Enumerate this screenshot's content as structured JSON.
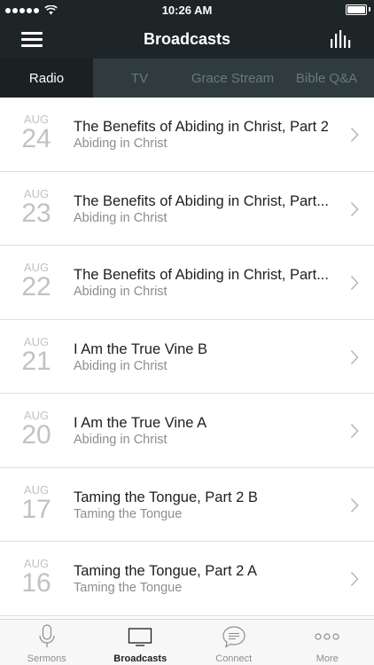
{
  "status": {
    "time": "10:26 AM"
  },
  "nav": {
    "title": "Broadcasts"
  },
  "tabs": [
    {
      "label": "Radio",
      "active": true
    },
    {
      "label": "TV",
      "active": false
    },
    {
      "label": "Grace Stream",
      "active": false
    },
    {
      "label": "Bible Q&A",
      "active": false
    }
  ],
  "broadcasts": [
    {
      "month": "AUG",
      "day": "24",
      "title": "The Benefits of Abiding in Christ, Part 2",
      "series": "Abiding in Christ"
    },
    {
      "month": "AUG",
      "day": "23",
      "title": "The Benefits of Abiding in Christ, Part...",
      "series": "Abiding in Christ"
    },
    {
      "month": "AUG",
      "day": "22",
      "title": "The Benefits of Abiding in Christ, Part...",
      "series": "Abiding in Christ"
    },
    {
      "month": "AUG",
      "day": "21",
      "title": "I Am the True Vine B",
      "series": "Abiding in Christ"
    },
    {
      "month": "AUG",
      "day": "20",
      "title": "I Am the True Vine A",
      "series": "Abiding in Christ"
    },
    {
      "month": "AUG",
      "day": "17",
      "title": "Taming the Tongue, Part 2 B",
      "series": "Taming the Tongue"
    },
    {
      "month": "AUG",
      "day": "16",
      "title": "Taming the Tongue, Part 2 A",
      "series": "Taming the Tongue"
    }
  ],
  "bottom_tabs": [
    {
      "label": "Sermons",
      "icon": "microphone-icon",
      "active": false
    },
    {
      "label": "Broadcasts",
      "icon": "tv-icon",
      "active": true
    },
    {
      "label": "Connect",
      "icon": "chat-bubble-icon",
      "active": false
    },
    {
      "label": "More",
      "icon": "more-dots-icon",
      "active": false
    }
  ],
  "colors": {
    "nav_bg": "#1d2527",
    "tab_bg": "#2f3b3e",
    "tab_active_bg": "#1a2123",
    "date_gray": "#c2c2c2"
  }
}
